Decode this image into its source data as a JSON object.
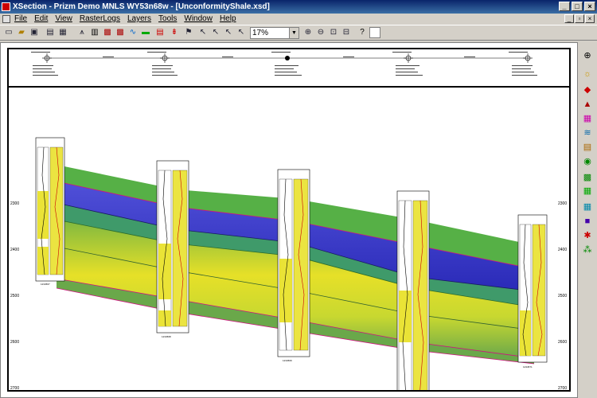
{
  "window": {
    "title": "XSection - Prizm Demo MNLS WY53n68w - [UnconformityShale.xsd]",
    "minimize": "_",
    "maximize": "□",
    "close": "×"
  },
  "menu": [
    "File",
    "Edit",
    "View",
    "RasterLogs",
    "Layers",
    "Tools",
    "Window",
    "Help"
  ],
  "toolbar": {
    "zoom_value": "17%",
    "icons": [
      "new-icon",
      "open-icon",
      "save-icon",
      "print-icon",
      "preview-icon",
      "well-icon",
      "grid-icon",
      "log-icon",
      "wave-icon",
      "color-icon",
      "layer-icon",
      "raster-icon",
      "pointer-icon"
    ]
  },
  "depth_ticks_right": [
    "2300",
    "2400",
    "2500",
    "2600",
    "2700"
  ],
  "wells": [
    {
      "id": "w1",
      "name": "1234567"
    },
    {
      "id": "w2",
      "name": "1234568"
    },
    {
      "id": "w3",
      "name": "1234569"
    },
    {
      "id": "w4",
      "name": "1234570"
    },
    {
      "id": "w5",
      "name": "1234571"
    }
  ],
  "colors": {
    "blue_layer": "#3a3acf",
    "yellow_layer": "#e8e020",
    "green_layer": "#4aa64a",
    "marker": "#d01080"
  }
}
